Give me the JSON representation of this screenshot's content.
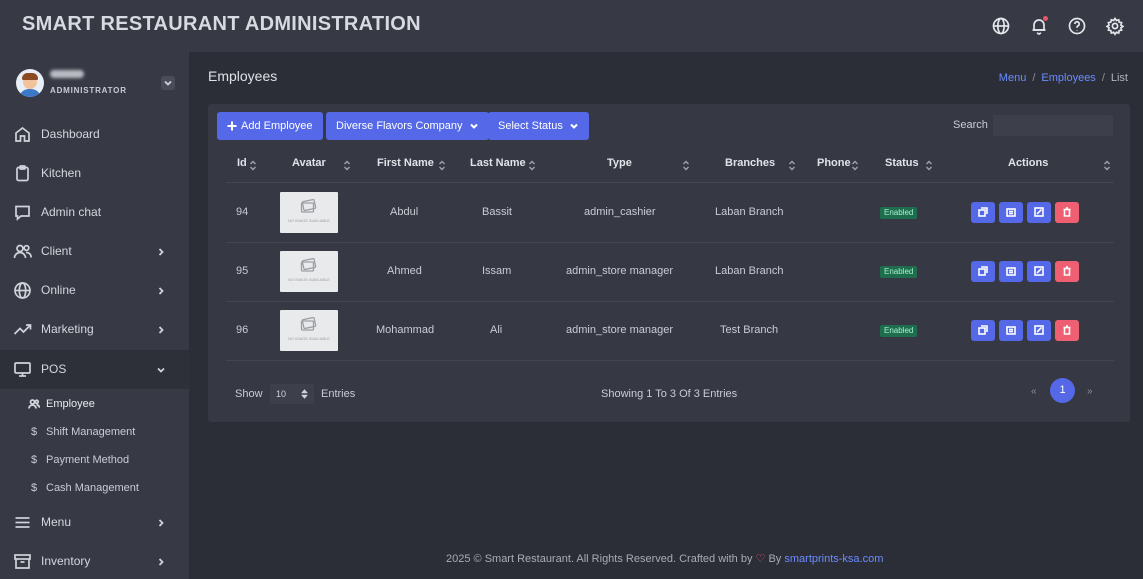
{
  "app": {
    "title": "SMART RESTAURANT ADMINISTRATION"
  },
  "topbar_icons": [
    "globe-icon",
    "bell-icon",
    "help-icon",
    "settings-icon"
  ],
  "user": {
    "role": "ADMINISTRATOR"
  },
  "sidebar": {
    "items": [
      {
        "label": "Dashboard",
        "icon": "home-icon"
      },
      {
        "label": "Kitchen",
        "icon": "clipboard-icon"
      },
      {
        "label": "Admin chat",
        "icon": "chat-icon"
      },
      {
        "label": "Client",
        "icon": "users-icon",
        "arrow": "chevron-right"
      },
      {
        "label": "Online",
        "icon": "globe-icon",
        "arrow": "chevron-right"
      },
      {
        "label": "Marketing",
        "icon": "trend-icon",
        "arrow": "chevron-right"
      },
      {
        "label": "POS",
        "icon": "monitor-icon",
        "arrow": "chevron-down",
        "active": true
      },
      {
        "label": "Menu",
        "icon": "menu-icon",
        "arrow": "chevron-right"
      },
      {
        "label": "Inventory",
        "icon": "archive-icon",
        "arrow": "chevron-right"
      }
    ],
    "pos_subitems": [
      {
        "label": "Employee",
        "icon": "users-icon",
        "active": true
      },
      {
        "label": "Shift Management",
        "icon": "dollar-icon"
      },
      {
        "label": "Payment Method",
        "icon": "dollar-icon"
      },
      {
        "label": "Cash Management",
        "icon": "dollar-icon"
      }
    ]
  },
  "page": {
    "title": "Employees",
    "breadcrumb": {
      "menu": "Menu",
      "sep": "/",
      "employees": "Employees",
      "current": "List"
    }
  },
  "toolbar": {
    "add_label": "Add Employee",
    "company_label": "Diverse Flavors Company",
    "status_label": "Select Status",
    "search_label": "Search",
    "search_value": ""
  },
  "table": {
    "headers": {
      "id": "Id",
      "avatar": "Avatar",
      "first_name": "First Name",
      "last_name": "Last Name",
      "type": "Type",
      "branches": "Branches",
      "phone": "Phone",
      "status": "Status",
      "actions": "Actions"
    },
    "placeholder_text": "NO IMAGE AVAILABLE",
    "rows": [
      {
        "id": "94",
        "first_name": "Abdul",
        "last_name": "Bassit",
        "type": "admin_cashier",
        "branch": "Laban Branch",
        "phone": "",
        "status": "Enabled"
      },
      {
        "id": "95",
        "first_name": "Ahmed",
        "last_name": "Issam",
        "type": "admin_store manager",
        "branch": "Laban Branch",
        "phone": "",
        "status": "Enabled"
      },
      {
        "id": "96",
        "first_name": "Mohammad",
        "last_name": "Ali",
        "type": "admin_store manager",
        "branch": "Test Branch",
        "phone": "",
        "status": "Enabled"
      }
    ]
  },
  "pagination": {
    "show_label": "Show",
    "page_size": "10",
    "entries_label": "Entries",
    "info": "Showing 1 To 3 Of 3 Entries",
    "prev": "«",
    "current": "1",
    "next": "»"
  },
  "footer": {
    "text": "2025 © Smart Restaurant. All Rights Reserved. Crafted with by",
    "heart": "♡",
    "by": "By",
    "link": "smartprints-ksa.com"
  },
  "colors": {
    "accent": "#5468e8",
    "danger": "#ee5f72",
    "success_badge": "#1e6e4e",
    "link": "#6b8cff"
  }
}
